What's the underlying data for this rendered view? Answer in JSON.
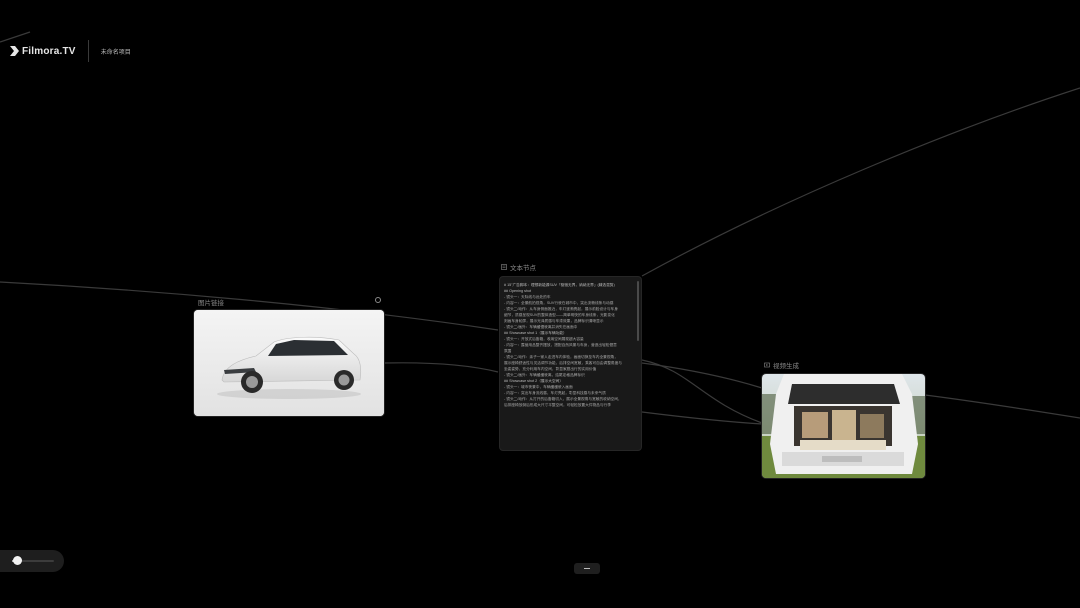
{
  "app": {
    "brand": "Filmora.TV",
    "project_name": "未命名项目"
  },
  "nodes": {
    "upload": {
      "title": "图片链接"
    },
    "script": {
      "title": "文本节点",
      "lines": [
        "# 15\"广告脚本：理想新能源SUV「驱驰无界，纳纳无界」(精选混剪)",
        "## Opening shot",
        "- 镜头一：天际线与远处的车",
        "- 内容一：全景航拍视角，SUV行驶在城市中，突出流畅线条与动感",
        "- 镜头二/动作：从车身侧面推近，车灯逐渐亮起，展示前脸设计与车身",
        "细节，质感呈现SUV的整体造型——简单明快的车身线条，光影变化",
        "刻画车身轮廓，展示光泽质感与车漆效果，品牌标识清晰显示",
        "- 镜头二/画外：车辆缓慢驶离并消失在画面中",
        "## Showcase shot 1（展示车辆功能）",
        "- 镜头一：开放式后备箱，收纳空间展现超大容量",
        "- 内容一：露营用品整齐摆放，搭配自然风景与车身，营造出轻松惬意",
        "氛围",
        "- 镜头二/动作：亲子一家人走进车内体验，画面切换至车内全景视角，",
        "展示座椅舒适性与灵活调节功能，后排空间宽敞，乘客可自由调整角度与",
        "坐姿姿势，充分利用车内空间，彰显家庭出行的实用价值",
        "- 镜头二/画外：车辆缓缓驶离，结尾定格品牌标识",
        "## Showcase shot 2（展示大空间）",
        "- 镜头一：城市夜景中，车辆缓缓驶入画面",
        "- 内容一：突出车身流线感，车灯亮起，彰显科技感与未来气质",
        "- 镜头二/动作：从打开的后备箱切入，展示全景视角与宽敞的收纳空间，",
        "后排座椅放倒后形成大尺寸平整空间，可轻松放置大件物品与行李"
      ]
    },
    "output": {
      "title": "视频生成"
    }
  },
  "colors": {
    "background": "#000000",
    "node": "#191919",
    "edge": "#3c3c3c"
  },
  "zoom": {
    "level": 0.12
  }
}
